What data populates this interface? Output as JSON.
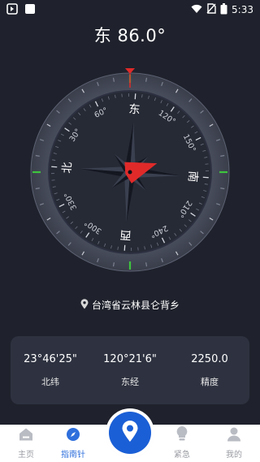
{
  "status_bar": {
    "time": "5:33"
  },
  "heading": {
    "direction": "东",
    "degrees": "86.0°"
  },
  "compass": {
    "heading_deg": 86,
    "cardinals": {
      "north": "北",
      "east": "东",
      "south": "南",
      "west": "西"
    },
    "degree_labels": [
      "30°",
      "60°",
      "120°",
      "150°",
      "210°",
      "240°",
      "300°",
      "330°"
    ],
    "pointer_color": "#e02a2a",
    "accent_tick_color": "#3ec53e"
  },
  "location": {
    "text": "台湾省云林县仑背乡"
  },
  "info": {
    "latitude": {
      "value": "23°46'25\"",
      "label": "北纬"
    },
    "longitude": {
      "value": "120°21'6\"",
      "label": "东经"
    },
    "accuracy": {
      "value": "2250.0",
      "label": "精度"
    }
  },
  "tabbar": {
    "home": "主页",
    "compass": "指南针",
    "emergency": "紧急",
    "mine": "我的",
    "active_color": "#2e6fdc"
  }
}
